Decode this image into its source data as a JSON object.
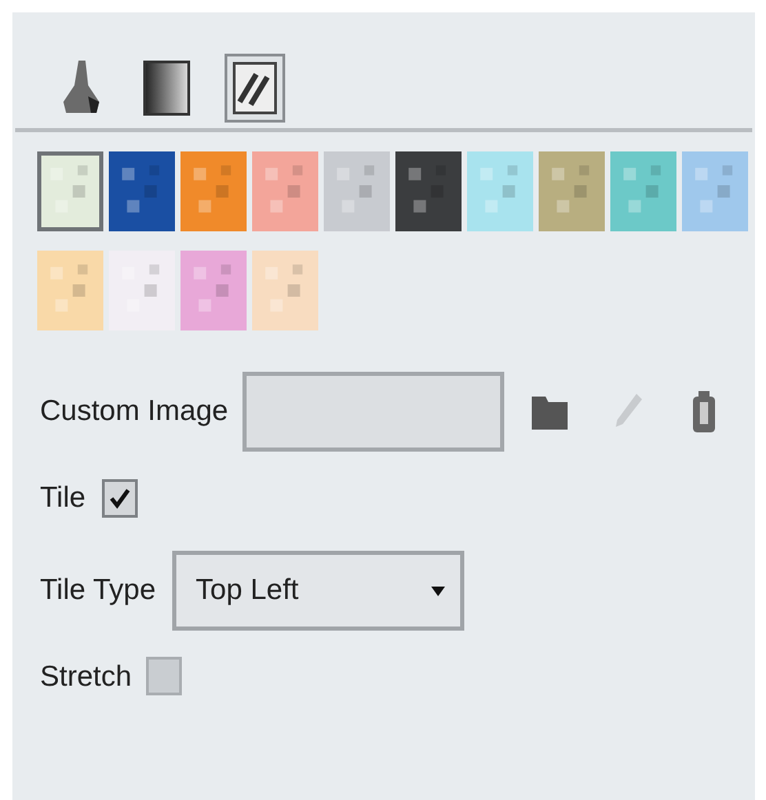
{
  "fill_tools": [
    {
      "kind": "solid",
      "selected": false
    },
    {
      "kind": "gradient",
      "selected": false
    },
    {
      "kind": "pattern",
      "selected": true
    }
  ],
  "swatches": [
    {
      "color": "#e3ecdc",
      "selected": true
    },
    {
      "color": "#1a4fa3",
      "selected": false
    },
    {
      "color": "#f08a2a",
      "selected": false
    },
    {
      "color": "#f3a59a",
      "selected": false
    },
    {
      "color": "#c8cbd0",
      "selected": false
    },
    {
      "color": "#3b3d3f",
      "selected": false
    },
    {
      "color": "#a8e3ee",
      "selected": false
    },
    {
      "color": "#b8ae80",
      "selected": false
    },
    {
      "color": "#6cc9c8",
      "selected": false
    },
    {
      "color": "#9fc8ec",
      "selected": false
    },
    {
      "color": "#f9d9a8",
      "selected": false
    },
    {
      "color": "#f2eef4",
      "selected": false
    },
    {
      "color": "#e8a8d8",
      "selected": false
    },
    {
      "color": "#f8dcc0",
      "selected": false
    }
  ],
  "custom_image": {
    "label": "Custom Image"
  },
  "tile": {
    "label": "Tile",
    "checked": true
  },
  "tile_type": {
    "label": "Tile Type",
    "value": "Top Left"
  },
  "stretch": {
    "label": "Stretch",
    "checked": false
  }
}
